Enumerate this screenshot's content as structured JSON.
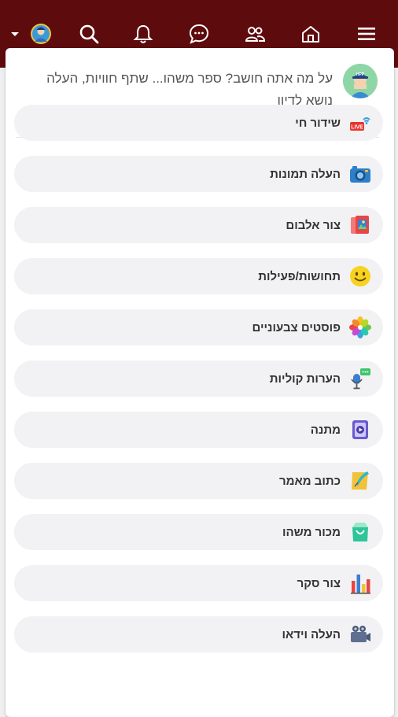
{
  "composer": {
    "prompt": "על מה אתה חושב? ספר משהו... שתף חוויות, העלה נושא לדיון"
  },
  "nav": {
    "icons": [
      "dropdown-arrow-icon",
      "user-avatar-icon",
      "search-icon",
      "bell-icon",
      "chat-icon",
      "friends-icon",
      "home-icon",
      "hamburger-menu-icon"
    ]
  },
  "menu": {
    "items": [
      {
        "label": "שידור חי",
        "icon": "live-broadcast-icon"
      },
      {
        "label": "העלה תמונות",
        "icon": "camera-icon"
      },
      {
        "label": "צור אלבום",
        "icon": "album-icon"
      },
      {
        "label": "תחושות/פעילות",
        "icon": "smiley-icon"
      },
      {
        "label": "פוסטים צבעוניים",
        "icon": "color-flower-icon"
      },
      {
        "label": "הערות קוליות",
        "icon": "microphone-icon"
      },
      {
        "label": "מתנה",
        "icon": "gift-icon"
      },
      {
        "label": "כתוב מאמר",
        "icon": "quill-article-icon"
      },
      {
        "label": "מכור משהו",
        "icon": "shopping-bag-icon"
      },
      {
        "label": "צור סקר",
        "icon": "poll-bars-icon"
      },
      {
        "label": "העלה וידאו",
        "icon": "video-camera-icon"
      }
    ]
  },
  "colors": {
    "topbar": "#5e0b0d",
    "card": "#ffffff",
    "pill": "#f2f2f4"
  }
}
